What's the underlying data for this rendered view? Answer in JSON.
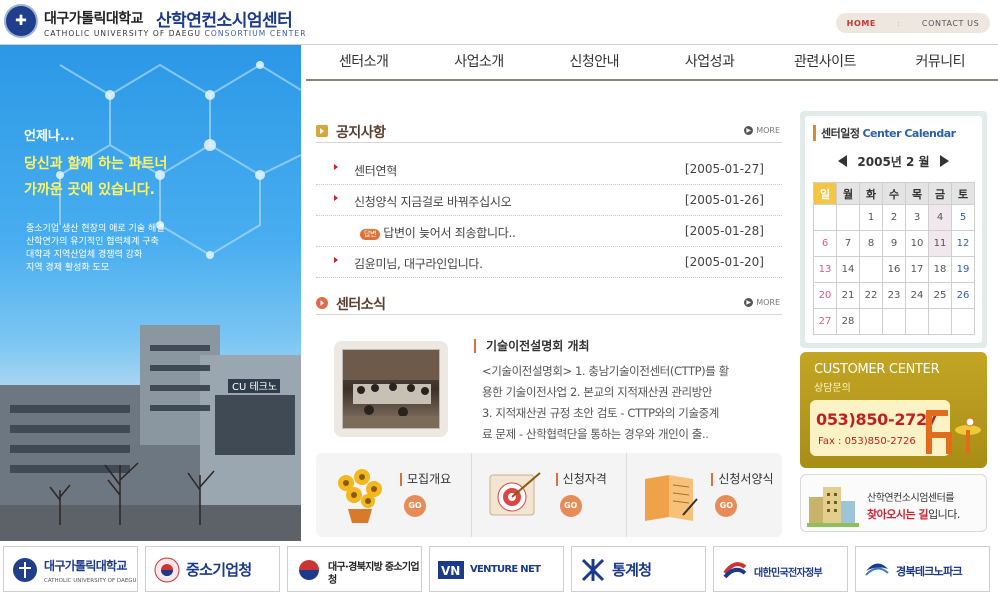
{
  "header": {
    "logo_univ": "대구가톨릭대학교",
    "logo_center": "산학연컨소시엄센터",
    "logo_eng_a": "CATHOLIC UNIVERSITY OF DAEGU",
    "logo_eng_b": "CONSORTIUM CENTER",
    "util_home": "HOME",
    "util_sep": ":",
    "util_contact": "CONTACT US"
  },
  "nav": {
    "items": [
      "센터소개",
      "사업소개",
      "신청안내",
      "사업성과",
      "관련사이트",
      "커뮤니티"
    ]
  },
  "hero": {
    "line1": "언제나...",
    "line2": "당신과 함께 하는 파트너",
    "line3": "가까운 곳에 있습니다.",
    "body": [
      "중소기업 생산 현장의 애로 기술 해결",
      "산학연가의 유기적인 협력체계 구축",
      "대학과 지역산업체 경쟁력 강화",
      "지역 경제 활성화 도모"
    ],
    "building_sign": "CU 테크노"
  },
  "notice": {
    "title": "공지사항",
    "more": "MORE",
    "rows": [
      {
        "title": "센터연혁",
        "date": "[2005-01-27]",
        "reply": false
      },
      {
        "title": "신청양식 지금걸로 바꿔주십시오",
        "date": "[2005-01-26]",
        "reply": false
      },
      {
        "title": "답변이 늦어서 죄송합니다..",
        "date": "[2005-01-28]",
        "reply": true
      },
      {
        "title": "김윤미님, 대구라인입니다.",
        "date": "[2005-01-20]",
        "reply": false
      }
    ],
    "reply_badge": "답변"
  },
  "news": {
    "title": "센터소식",
    "more": "MORE",
    "article_title": "기술이전설명회 개최",
    "article_lines": [
      "<기술이전설명회> 1. 충남기술이전센터(CTTP)를 활",
      "용한 기술이전사업 2. 본교의 지적재산권 관리방안",
      "3. 지적재산권 규정 초안 검토 - CTTP와의 기술중계",
      "료 문제 - 산학협력단을 통하는 경우와 개인이 출.."
    ]
  },
  "quick": [
    {
      "label": "모집개요",
      "go": "GO",
      "icon": "flower-pot-icon"
    },
    {
      "label": "신청자격",
      "go": "GO",
      "icon": "target-icon"
    },
    {
      "label": "신청서양식",
      "go": "GO",
      "icon": "folder-icon"
    }
  ],
  "calendar": {
    "title": "센터일정",
    "title_eng": "Center Calendar",
    "year": "2005년",
    "month": "2 월",
    "weekdays": [
      "일",
      "월",
      "화",
      "수",
      "목",
      "금",
      "토"
    ],
    "weeks": [
      [
        "",
        "",
        "1",
        "2",
        "3",
        "4",
        "5"
      ],
      [
        "6",
        "7",
        "8",
        "9",
        "10",
        "11",
        "12"
      ],
      [
        "13",
        "14",
        "",
        "16",
        "17",
        "18",
        "19"
      ],
      [
        "20",
        "21",
        "22",
        "23",
        "24",
        "25",
        "26"
      ],
      [
        "27",
        "28",
        "",
        "",
        "",
        "",
        ""
      ]
    ]
  },
  "customer": {
    "title": "CUSTOMER CENTER",
    "subtitle": "상담문의",
    "phone": "053)850-2727",
    "fax": "Fax : 053)850-2726"
  },
  "visit": {
    "line1": "산학연컨소시엄센터를",
    "line2_hl": "찾아오시는 길",
    "line2_rest": "입니다."
  },
  "banners": [
    {
      "text": "대구가톨릭대학교",
      "sub": "CATHOLIC UNIVERSITY OF DAEGU",
      "icon": "university-emblem-icon"
    },
    {
      "text": "중소기업청",
      "sub": "",
      "icon": "government-emblem-icon"
    },
    {
      "text": "대구·경북지방 중소기업청",
      "sub": "",
      "icon": "taegeuk-icon"
    },
    {
      "text": "VENTURE NET",
      "sub": "",
      "icon": "vn-logo-icon"
    },
    {
      "text": "통계청",
      "sub": "",
      "icon": "statistics-logo-icon"
    },
    {
      "text": "대한민국전자정부",
      "sub": "",
      "icon": "egov-logo-icon"
    },
    {
      "text": "경북테크노파크",
      "sub": "",
      "icon": "technopark-logo-icon"
    }
  ]
}
